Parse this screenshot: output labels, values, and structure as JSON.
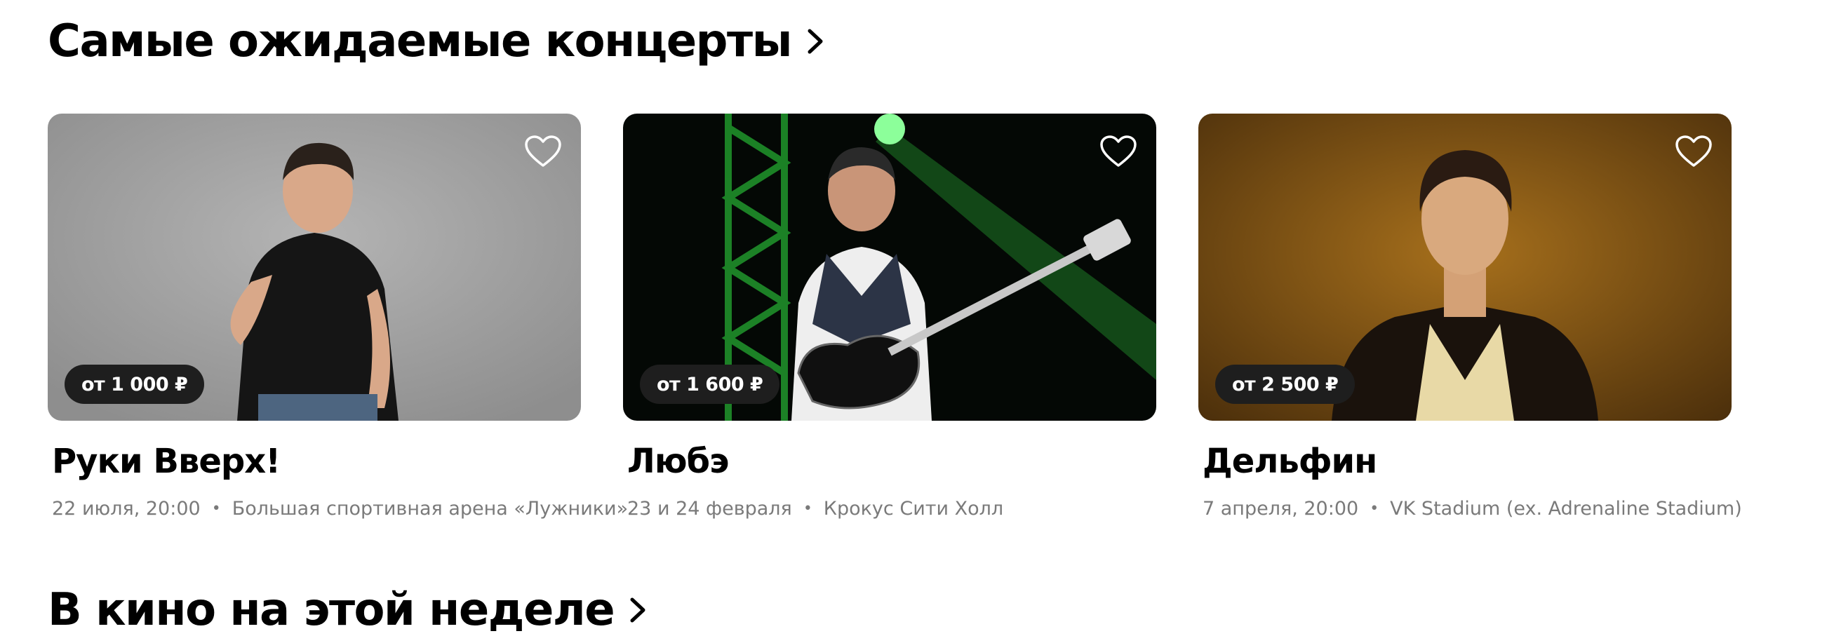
{
  "section": {
    "title": "Самые ожидаемые концерты"
  },
  "cards": [
    {
      "title": "Руки Вверх!",
      "price": "от 1 000 ₽",
      "date": "22 июля, 20:00",
      "venue": "Большая спортивная арена «Лужники»"
    },
    {
      "title": "Любэ",
      "price": "от 1 600 ₽",
      "date": "23 и 24 февраля",
      "venue": "Крокус Сити Холл"
    },
    {
      "title": "Дельфин",
      "price": "от 2 500 ₽",
      "date": "7 апреля, 20:00",
      "venue": "VK Stadium (ex. Adrenaline Stadium)"
    }
  ],
  "next_section": {
    "title": "В кино на этой неделе"
  },
  "colors": {
    "badge_bg": "#1e1e1e",
    "meta_text": "#7a7a7a"
  }
}
